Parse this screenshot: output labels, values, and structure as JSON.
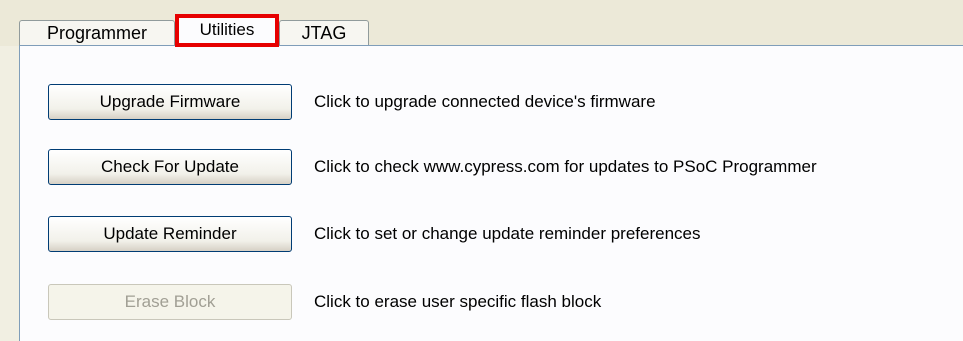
{
  "tabs": {
    "programmer": "Programmer",
    "utilities": "Utilities",
    "jtag": "JTAG"
  },
  "active_tab": "Utilities",
  "highlight_color": "#e60000",
  "utilities": {
    "rows": [
      {
        "button": "Upgrade Firmware",
        "description": "Click to upgrade connected device's firmware",
        "enabled": true
      },
      {
        "button": "Check For Update",
        "description": "Click to check www.cypress.com for updates to PSoC Programmer",
        "enabled": true
      },
      {
        "button": "Update Reminder",
        "description": "Click to set or change update reminder preferences",
        "enabled": true
      },
      {
        "button": "Erase Block",
        "description": "Click to erase user specific flash block",
        "enabled": false
      }
    ]
  }
}
